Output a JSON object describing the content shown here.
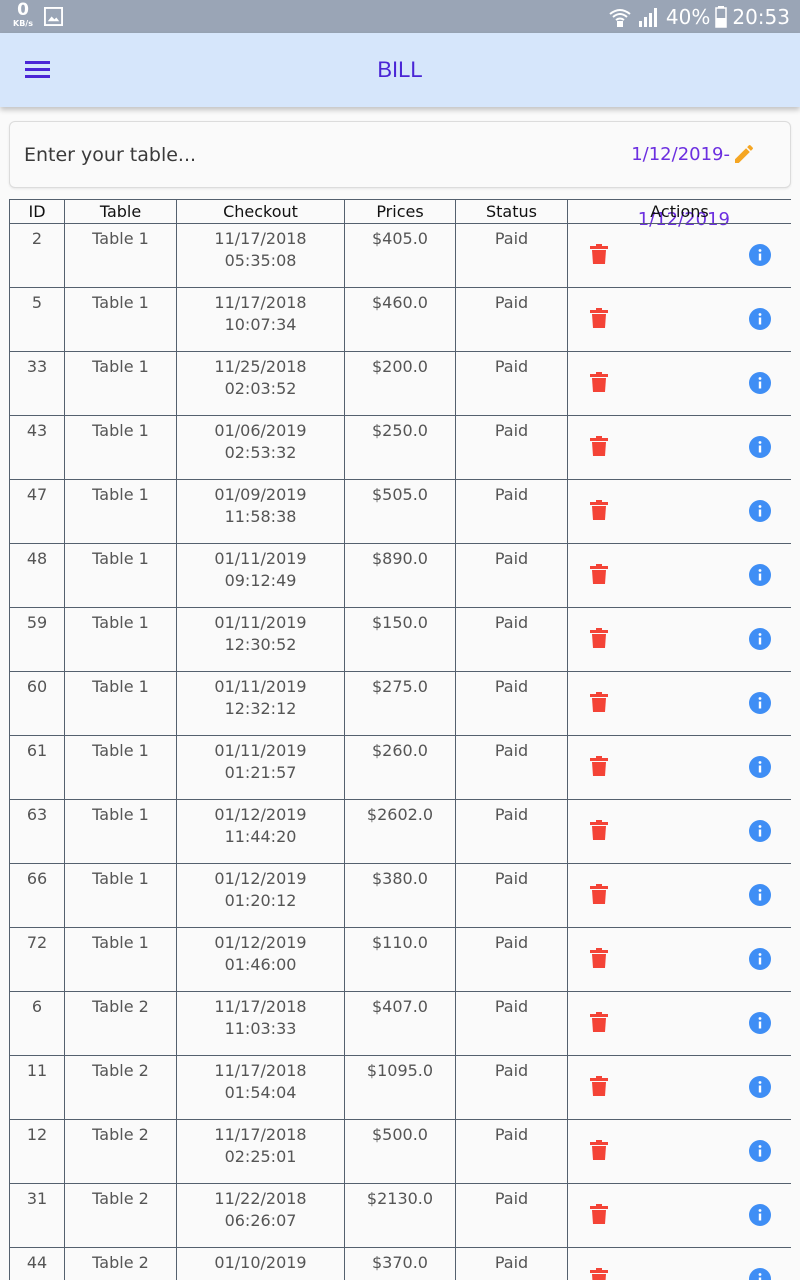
{
  "status_bar": {
    "speed_value": "0",
    "speed_unit": "KB/s",
    "battery_percent": "40%",
    "time": "20:53"
  },
  "app_bar": {
    "title": "BILL"
  },
  "search": {
    "placeholder": "Enter your table...",
    "date_range": "1/12/2019-1/12/2019"
  },
  "table": {
    "headers": [
      "ID",
      "Table",
      "Checkout",
      "Prices",
      "Status",
      "Actions"
    ],
    "rows": [
      {
        "id": "2",
        "table": "Table 1",
        "date": "11/17/2018",
        "time": "05:35:08",
        "price": "$405.0",
        "status": "Paid"
      },
      {
        "id": "5",
        "table": "Table 1",
        "date": "11/17/2018",
        "time": "10:07:34",
        "price": "$460.0",
        "status": "Paid"
      },
      {
        "id": "33",
        "table": "Table 1",
        "date": "11/25/2018",
        "time": "02:03:52",
        "price": "$200.0",
        "status": "Paid"
      },
      {
        "id": "43",
        "table": "Table 1",
        "date": "01/06/2019",
        "time": "02:53:32",
        "price": "$250.0",
        "status": "Paid"
      },
      {
        "id": "47",
        "table": "Table 1",
        "date": "01/09/2019",
        "time": "11:58:38",
        "price": "$505.0",
        "status": "Paid"
      },
      {
        "id": "48",
        "table": "Table 1",
        "date": "01/11/2019",
        "time": "09:12:49",
        "price": "$890.0",
        "status": "Paid"
      },
      {
        "id": "59",
        "table": "Table 1",
        "date": "01/11/2019",
        "time": "12:30:52",
        "price": "$150.0",
        "status": "Paid"
      },
      {
        "id": "60",
        "table": "Table 1",
        "date": "01/11/2019",
        "time": "12:32:12",
        "price": "$275.0",
        "status": "Paid"
      },
      {
        "id": "61",
        "table": "Table 1",
        "date": "01/11/2019",
        "time": "01:21:57",
        "price": "$260.0",
        "status": "Paid"
      },
      {
        "id": "63",
        "table": "Table 1",
        "date": "01/12/2019",
        "time": "11:44:20",
        "price": "$2602.0",
        "status": "Paid"
      },
      {
        "id": "66",
        "table": "Table 1",
        "date": "01/12/2019",
        "time": "01:20:12",
        "price": "$380.0",
        "status": "Paid"
      },
      {
        "id": "72",
        "table": "Table 1",
        "date": "01/12/2019",
        "time": "01:46:00",
        "price": "$110.0",
        "status": "Paid"
      },
      {
        "id": "6",
        "table": "Table 2",
        "date": "11/17/2018",
        "time": "11:03:33",
        "price": "$407.0",
        "status": "Paid"
      },
      {
        "id": "11",
        "table": "Table 2",
        "date": "11/17/2018",
        "time": "01:54:04",
        "price": "$1095.0",
        "status": "Paid"
      },
      {
        "id": "12",
        "table": "Table 2",
        "date": "11/17/2018",
        "time": "02:25:01",
        "price": "$500.0",
        "status": "Paid"
      },
      {
        "id": "31",
        "table": "Table 2",
        "date": "11/22/2018",
        "time": "06:26:07",
        "price": "$2130.0",
        "status": "Paid"
      },
      {
        "id": "44",
        "table": "Table 2",
        "date": "01/10/2019",
        "time": "",
        "price": "$370.0",
        "status": "Paid"
      }
    ]
  },
  "icons": {
    "menu": "menu-icon",
    "edit": "pencil-icon",
    "delete": "trash-icon",
    "info": "info-icon"
  },
  "colors": {
    "app_bar_bg": "#d6e6fb",
    "accent": "#4a25d6",
    "date_range": "#6c2fe0",
    "edit_icon": "#f5a623",
    "delete_icon": "#f44336",
    "info_icon": "#3f8ef5",
    "status_bar": "#9aa5b6"
  }
}
